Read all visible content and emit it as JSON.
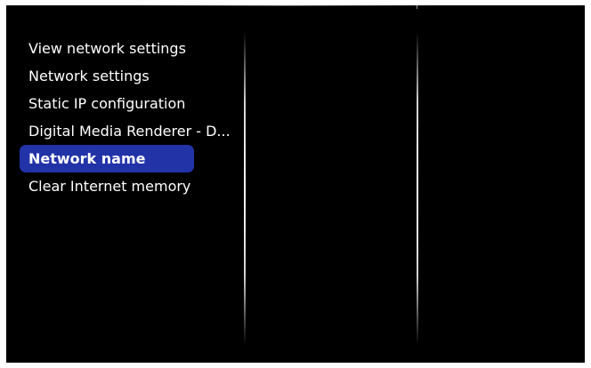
{
  "menu": {
    "items": [
      {
        "label": "View network settings",
        "selected": false
      },
      {
        "label": "Network settings",
        "selected": false
      },
      {
        "label": "Static IP configuration",
        "selected": false
      },
      {
        "label": "Digital Media Renderer - D...",
        "selected": false
      },
      {
        "label": "Network name",
        "selected": true
      },
      {
        "label": "Clear Internet memory",
        "selected": false
      }
    ]
  },
  "colors": {
    "background": "#000000",
    "text": "#ffffff",
    "selection": "#2233a8"
  }
}
